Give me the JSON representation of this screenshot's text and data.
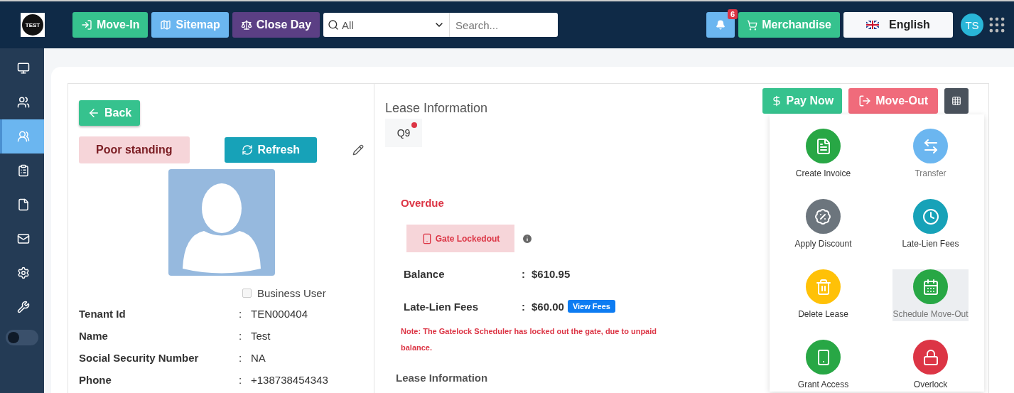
{
  "topbar": {
    "logo": "TEST",
    "buttons": [
      {
        "label": "Move-In",
        "color": "#36c28e"
      },
      {
        "label": "Sitemap",
        "color": "#6bb6f0"
      },
      {
        "label": "Close Day",
        "color": "#5b3f84"
      }
    ],
    "search_scope": "All",
    "search": {
      "placeholder": "Search..."
    },
    "notifications": "6",
    "merchandise": "Merchandise",
    "language": "English",
    "avatar": "TS"
  },
  "sidebar": {
    "items": [
      {
        "selected": false
      },
      {
        "selected": false
      },
      {
        "selected": true
      },
      {
        "selected": false
      },
      {
        "selected": false
      },
      {
        "selected": false
      },
      {
        "selected": false
      },
      {
        "selected": false
      }
    ],
    "toggle": {
      "on": false
    }
  },
  "tenant": {
    "back": "Back",
    "standing": "Poor standing",
    "refresh": "Refresh",
    "business_user": {
      "label": "Business User",
      "checked": false
    },
    "fields": [
      {
        "label": "Tenant Id",
        "separator": ":",
        "value": "TEN000404"
      },
      {
        "label": "Name",
        "separator": ":",
        "value": "Test"
      },
      {
        "label": "Social Security Number",
        "separator": ":",
        "value": "NA"
      },
      {
        "label": "Phone",
        "separator": ":",
        "value": "+138738454343"
      }
    ]
  },
  "lease": {
    "title": "Lease Information",
    "units": [
      {
        "label": "Q9",
        "alert": true
      }
    ],
    "status": "Overdue",
    "gate": "Gate Lockedout",
    "rows": [
      {
        "label": "Balance",
        "separator": ":",
        "value": "$610.95"
      },
      {
        "label": "Late-Lien Fees",
        "separator": ":",
        "value": "$60.00",
        "action": "View Fees"
      }
    ],
    "note": "Note: The Gatelock Scheduler has locked out the gate, due to unpaid balance.",
    "subtitle": "Lease Information"
  },
  "actions": {
    "pay_now": "Pay Now",
    "move_out": "Move-Out",
    "menu": [
      {
        "label": "Create Invoice",
        "color": "#28a745",
        "disabled": false,
        "hovered": false
      },
      {
        "label": "Transfer",
        "color": "#6bb6f0",
        "disabled": true,
        "hovered": false
      },
      {
        "label": "Apply Discount",
        "color": "#6c757d",
        "disabled": false,
        "hovered": false
      },
      {
        "label": "Late-Lien Fees",
        "color": "#17a2b8",
        "disabled": false,
        "hovered": false
      },
      {
        "label": "Delete Lease",
        "color": "#ffc107",
        "disabled": false,
        "hovered": false
      },
      {
        "label": "Schedule Move-Out",
        "color": "#28a745",
        "disabled": true,
        "hovered": true
      },
      {
        "label": "Grant Access",
        "color": "#28a745",
        "disabled": false,
        "hovered": false
      },
      {
        "label": "Overlock",
        "color": "#dc3545",
        "disabled": false,
        "hovered": false
      }
    ]
  }
}
